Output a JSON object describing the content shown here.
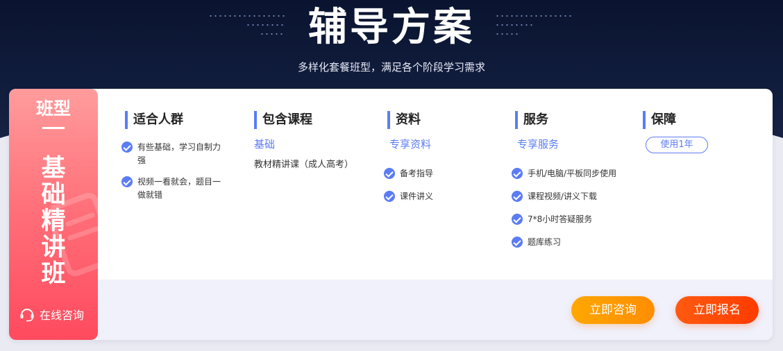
{
  "header": {
    "title": "辅导方案",
    "subtitle": "多样化套餐班型，满足各个阶段学习需求"
  },
  "plan": {
    "category": "班型一",
    "category_line1": "班型",
    "category_line2": "一",
    "name": "基础精讲班",
    "consult_label": "在线咨询"
  },
  "columns": {
    "audience": {
      "heading": "适合人群",
      "items": [
        "有些基础，学习自制力强",
        "视频一看就会，题目一做就错"
      ]
    },
    "courses": {
      "heading": "包含课程",
      "level": "基础",
      "course": "教材精讲课（成人高考）"
    },
    "materials": {
      "heading": "资料",
      "subtitle": "专享资料",
      "items": [
        "备考指导",
        "课件讲义"
      ]
    },
    "services": {
      "heading": "服务",
      "subtitle": "专享服务",
      "items": [
        "手机/电脑/平板同步使用",
        "课程视频/讲义下载",
        "7*8小时答疑服务",
        "题库练习"
      ]
    },
    "guarantee": {
      "heading": "保障",
      "badge": "使用1年"
    }
  },
  "actions": {
    "consult": "立即咨询",
    "enroll": "立即报名"
  },
  "colors": {
    "accent": "#5b7cf5",
    "consult_button": "#ff9900",
    "enroll_button": "#ff4b07",
    "side_gradient_top": "#ff9c9c",
    "side_gradient_bottom": "#ff4a5e",
    "hero_bg": "#0a1430"
  },
  "icons": {
    "check": "check-circle-icon",
    "consult": "headset-icon"
  }
}
